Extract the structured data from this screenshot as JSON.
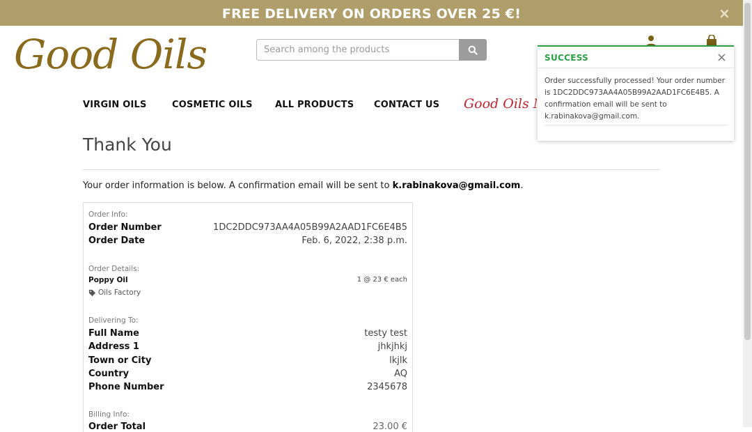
{
  "banner": {
    "text": "FREE DELIVERY ON ORDERS OVER 25 €!",
    "close": "×"
  },
  "logo": {
    "text": "Good Oils"
  },
  "search": {
    "placeholder": "Search among the products"
  },
  "nav": {
    "items": [
      "VIRGIN OILS",
      "COSMETIC OILS",
      "ALL PRODUCTS",
      "CONTACT US"
    ],
    "magazine": "Good Oils Magazine"
  },
  "page": {
    "title": "Thank You",
    "intro_prefix": "Your order information is below. A confirmation email will be sent to ",
    "intro_email": "k.rabinakova@gmail.com",
    "intro_suffix": "."
  },
  "order": {
    "info_label": "Order Info:",
    "number_label": "Order Number",
    "number_value": "1DC2DDC973AA4A05B99A2AAD1FC6E4B5",
    "date_label": "Order Date",
    "date_value": "Feb. 6, 2022, 2:38 p.m.",
    "details_label": "Order Details:",
    "item_name": "Poppy Oil",
    "item_qty": "1 @ 23 € each",
    "item_brand": "Oils Factory",
    "delivering_label": "Delivering To:",
    "full_name_label": "Full Name",
    "full_name_value": "testy test",
    "address_label": "Address 1",
    "address_value": "jhkjhkj",
    "town_label": "Town or City",
    "town_value": "lkjlk",
    "country_label": "Country",
    "country_value": "AQ",
    "phone_label": "Phone Number",
    "phone_value": "2345678",
    "billing_label": "Billing Info:",
    "total_label": "Order Total",
    "total_value": "23.00 €"
  },
  "toast": {
    "title": "SUCCESS",
    "close": "×",
    "message": "Order successfully processed! Your order number is 1DC2DDC973AA4A05B99A2AAD1FC6E4B5. A confirmation email will be sent to k.rabinakova@gmail.com."
  },
  "colors": {
    "banner": "#b09e6a",
    "logo": "#8a6a1c",
    "success": "#2aa043",
    "magazine": "#c0232e"
  }
}
